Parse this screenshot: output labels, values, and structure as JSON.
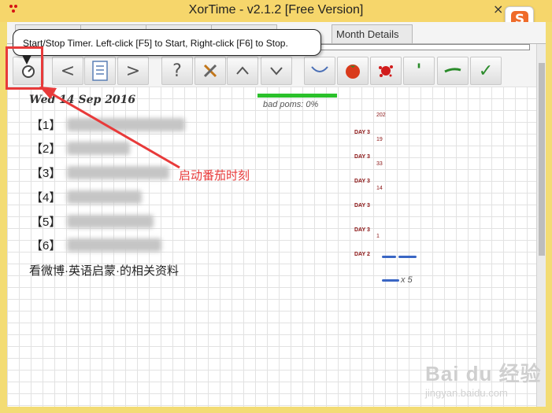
{
  "window": {
    "title": "XorTime - v2.1.2 [Free Version]",
    "close_glyph": "×"
  },
  "ime": {
    "letter": "S"
  },
  "tabs": [
    {
      "label": ""
    },
    {
      "label": ""
    },
    {
      "label": ""
    },
    {
      "label": ""
    },
    {
      "label": "Month Details"
    }
  ],
  "tooltip": {
    "text": "Start/Stop Timer. Left-click [F5] to Start, Right-click [F6] to Stop."
  },
  "toolbar": {
    "buttons": [
      {
        "name": "timer-button",
        "icon": "timer-icon",
        "glyph": ""
      },
      {
        "name": "prev-button",
        "icon": "chevron-left-icon",
        "glyph": "<"
      },
      {
        "name": "list-button",
        "icon": "list-icon",
        "glyph": ""
      },
      {
        "name": "next-button",
        "icon": "chevron-right-icon",
        "glyph": ">"
      },
      {
        "name": "help-button",
        "icon": "question-icon",
        "glyph": "?"
      },
      {
        "name": "settings-button",
        "icon": "tools-icon",
        "glyph": ""
      },
      {
        "name": "up-button",
        "icon": "chevron-up-icon",
        "glyph": "^"
      },
      {
        "name": "down-button",
        "icon": "chevron-down-icon",
        "glyph": "v"
      },
      {
        "name": "short-break-button",
        "icon": "arc-icon",
        "glyph": ""
      },
      {
        "name": "pomodoro-button",
        "icon": "tomato-icon",
        "glyph": ""
      },
      {
        "name": "splat-button",
        "icon": "splat-icon",
        "glyph": ""
      },
      {
        "name": "apostrophe-button",
        "icon": "apostrophe-icon",
        "glyph": "'"
      },
      {
        "name": "dash-button",
        "icon": "dash-icon",
        "glyph": ""
      },
      {
        "name": "done-button",
        "icon": "check-icon",
        "glyph": "✓"
      }
    ]
  },
  "main": {
    "date": "Wed 14 Sep 2016",
    "bad_poms": "bad poms: 0%",
    "tasks": [
      {
        "label": "【1】"
      },
      {
        "label": "【2】"
      },
      {
        "label": "【3】"
      },
      {
        "label": "【4】"
      },
      {
        "label": "【5】"
      },
      {
        "label": "【6】"
      }
    ],
    "note": "看微博·英语启蒙·的相关资料"
  },
  "stats": {
    "rows": [
      {
        "day": "DAY 3",
        "count": "202"
      },
      {
        "day": "DAY 3",
        "count": "19"
      },
      {
        "day": "DAY 3",
        "count": "33"
      },
      {
        "day": "DAY 3",
        "count": "14"
      },
      {
        "day": "DAY 3",
        "count": ""
      },
      {
        "day": "DAY 3",
        "count": "1"
      },
      {
        "day": "DAY 2",
        "count": ""
      }
    ],
    "multiplier": "x 5"
  },
  "annotation": {
    "text": "启动番茄时刻",
    "color": "#e83a3a"
  },
  "watermark": {
    "text": "Bai du 经验",
    "sub": "jingyan.baidu.com"
  },
  "colors": {
    "titlebar": "#f6d66b",
    "accent_green": "#2bc12b",
    "annotation_red": "#e83a3a"
  }
}
